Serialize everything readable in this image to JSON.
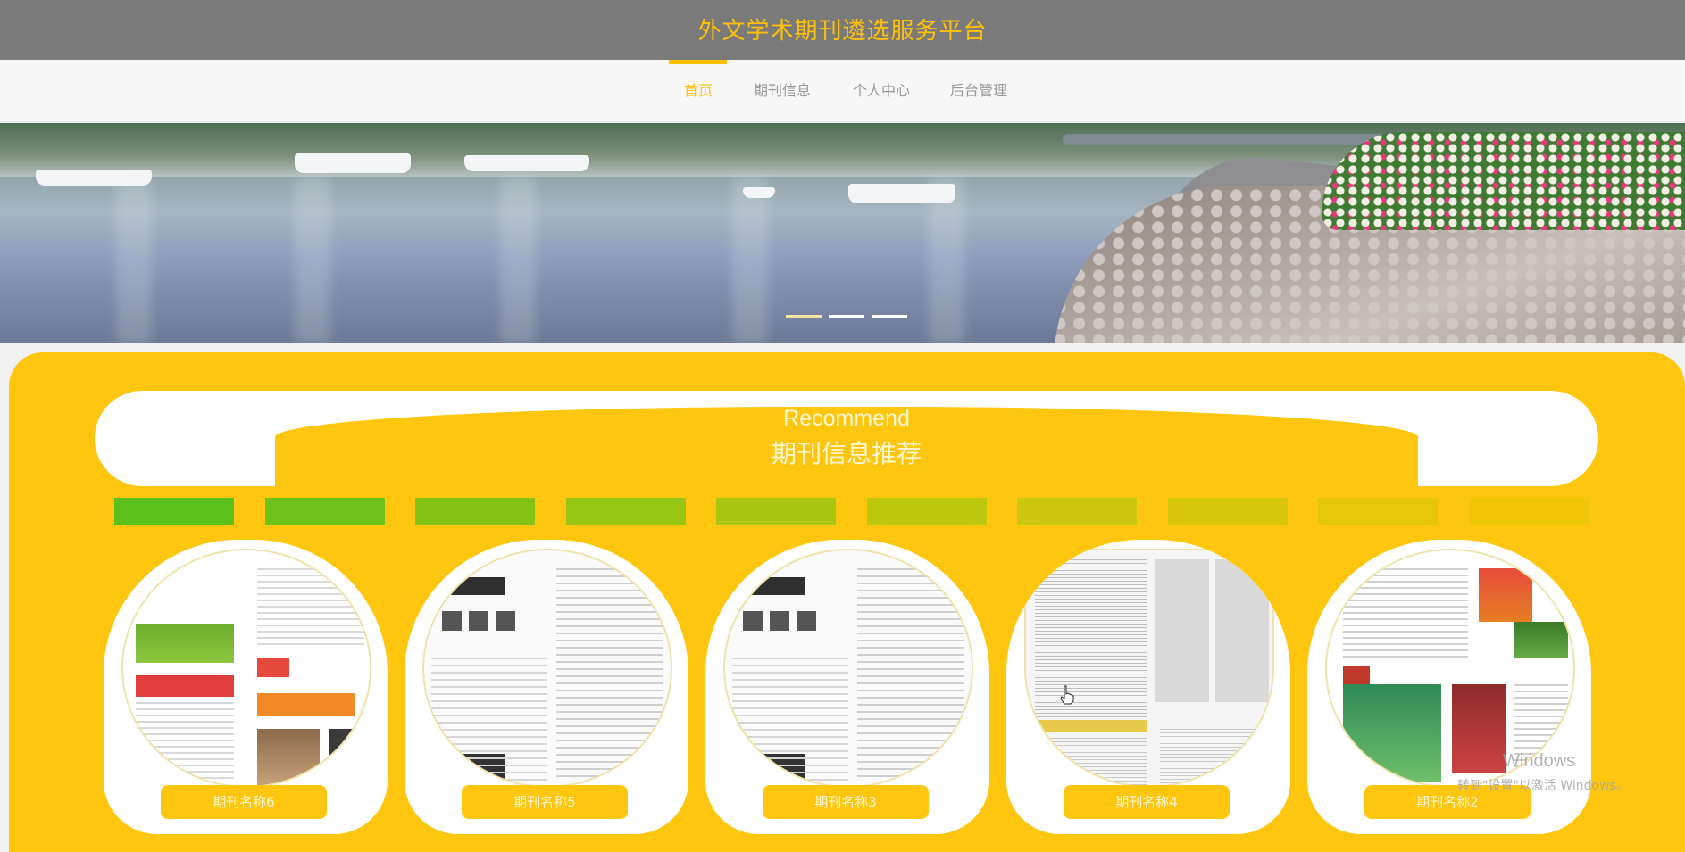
{
  "header": {
    "site_title": "外文学术期刊遴选服务平台"
  },
  "nav": {
    "items": [
      {
        "label": "首页",
        "active": true
      },
      {
        "label": "期刊信息",
        "active": false
      },
      {
        "label": "个人中心",
        "active": false
      },
      {
        "label": "后台管理",
        "active": false
      }
    ]
  },
  "banner": {
    "slides": 3,
    "active_slide": 1
  },
  "recommend": {
    "title_en": "Recommend",
    "title_cn": "期刊信息推荐",
    "strip_colors": [
      "#5bbf1c",
      "#6fc219",
      "#82c316",
      "#96c514",
      "#a9c611",
      "#bcc70e",
      "#cbc70c",
      "#d9c80a",
      "#e5c708",
      "#f0c706"
    ],
    "cards": [
      {
        "name": "期刊名称6",
        "thumbnail": "color-magazine"
      },
      {
        "name": "期刊名称5",
        "thumbnail": "text-article"
      },
      {
        "name": "期刊名称3",
        "thumbnail": "text-article"
      },
      {
        "name": "期刊名称4",
        "thumbnail": "newspaper"
      },
      {
        "name": "期刊名称2",
        "thumbnail": "school-newspaper"
      }
    ]
  },
  "watermark": {
    "line1": "Windows",
    "line2": "转到\"设置\"以激活 Windows。"
  },
  "colors": {
    "accent": "#ffc107",
    "section_bg": "#ffc60f",
    "topbar": "#7a7a7a"
  }
}
